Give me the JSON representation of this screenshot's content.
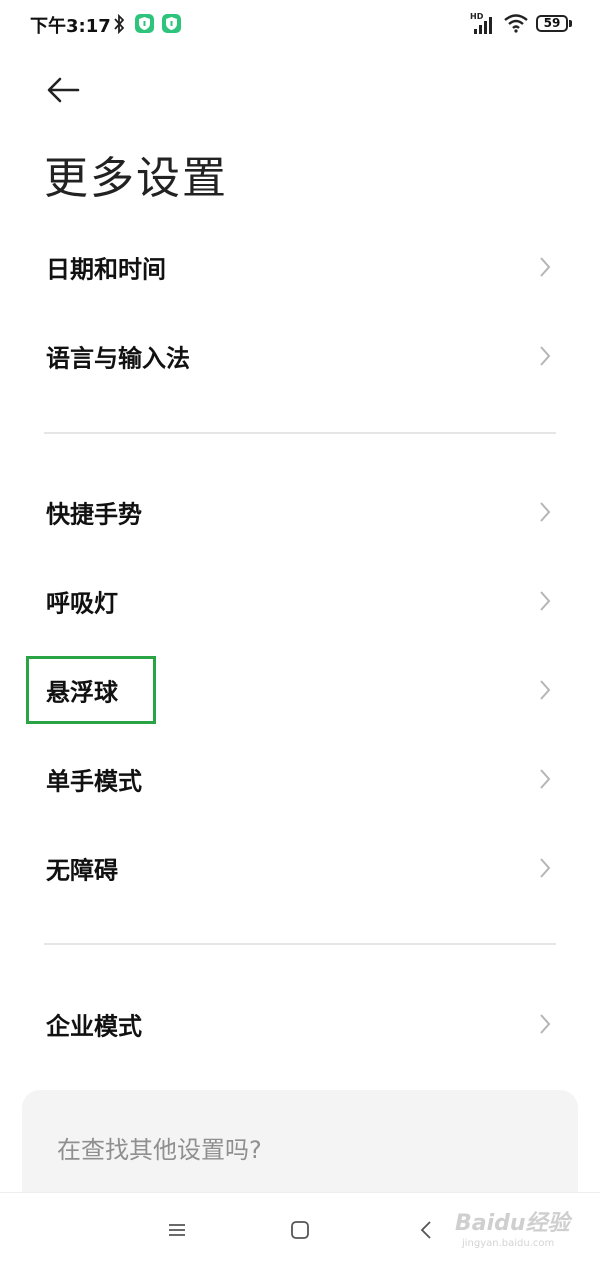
{
  "status_bar": {
    "time": "下午3:17",
    "network": "HD",
    "battery": "59",
    "icons": [
      "bluetooth-icon",
      "shield-icon",
      "shield-icon",
      "signal-icon",
      "wifi-icon",
      "battery-icon"
    ]
  },
  "header": {
    "back_icon": "arrow-left-icon",
    "title": "更多设置"
  },
  "settings": {
    "group1": [
      "日期和时间",
      "语言与输入法"
    ],
    "group2": [
      "快捷手势",
      "呼吸灯",
      "悬浮球",
      "单手模式",
      "无障碍"
    ],
    "group3": [
      "企业模式"
    ]
  },
  "search_card": {
    "text": "在查找其他设置吗?"
  },
  "nav_bar": {
    "icons": [
      "menu-icon",
      "home-icon",
      "back-icon"
    ]
  },
  "watermark": {
    "brand": "Baidu经验",
    "url": "jingyan.baidu.com"
  },
  "colors": {
    "highlight": "#2aa344",
    "shield": "#2ec47c",
    "chevron": "#b5b5b5"
  }
}
